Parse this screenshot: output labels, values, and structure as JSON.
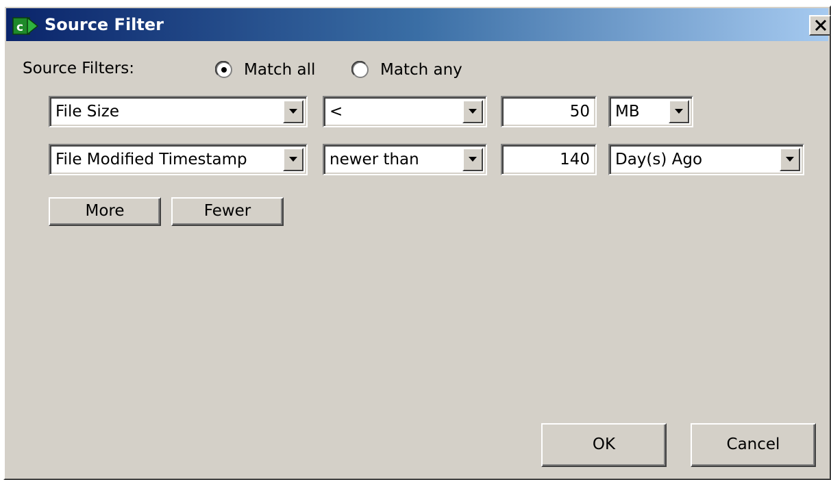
{
  "window": {
    "title": "Source Filter",
    "app_icon": "source-filter-app-icon",
    "close_icon": "close-icon",
    "titlebar_colors": [
      "#0a246a",
      "#a6caf0"
    ]
  },
  "match": {
    "label": "Source Filters:",
    "options": [
      {
        "label": "Match all",
        "selected": true
      },
      {
        "label": "Match any",
        "selected": false
      }
    ]
  },
  "filters": [
    {
      "field": "File Size",
      "operator": "<",
      "value": "50",
      "unit": "MB"
    },
    {
      "field": "File Modified Timestamp",
      "operator": "newer than",
      "value": "140",
      "unit": "Day(s) Ago"
    }
  ],
  "buttons": {
    "more": "More",
    "fewer": "Fewer",
    "ok": "OK",
    "cancel": "Cancel"
  }
}
